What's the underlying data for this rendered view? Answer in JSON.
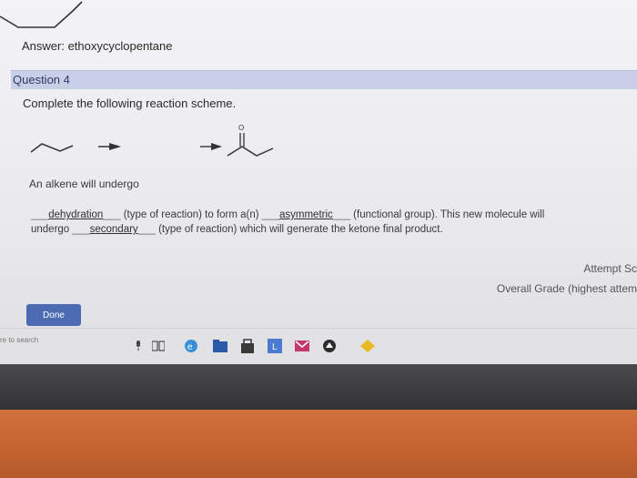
{
  "answer": {
    "text": "Answer: ethoxycyclopentane"
  },
  "question": {
    "header": "Question 4",
    "prompt": "Complete the following reaction scheme.",
    "ketone_label": "O",
    "intro": "An alkene will undergo",
    "blank1": "dehydration",
    "text1": "(type of reaction) to form a(n)",
    "blank2": "asymmetric",
    "text2": "(functional group). This new molecule will",
    "text3": "undergo",
    "blank3": "secondary",
    "text4": "(type of reaction) which will generate the ketone final product."
  },
  "grades": {
    "attempt": "Attempt Sc",
    "overall": "Overall Grade (highest attem"
  },
  "done_button": {
    "label": "Done"
  },
  "taskbar": {
    "search": "re to search"
  },
  "colors": {
    "header_bg": "#c9cfe6",
    "button": "#4d6bb3"
  }
}
